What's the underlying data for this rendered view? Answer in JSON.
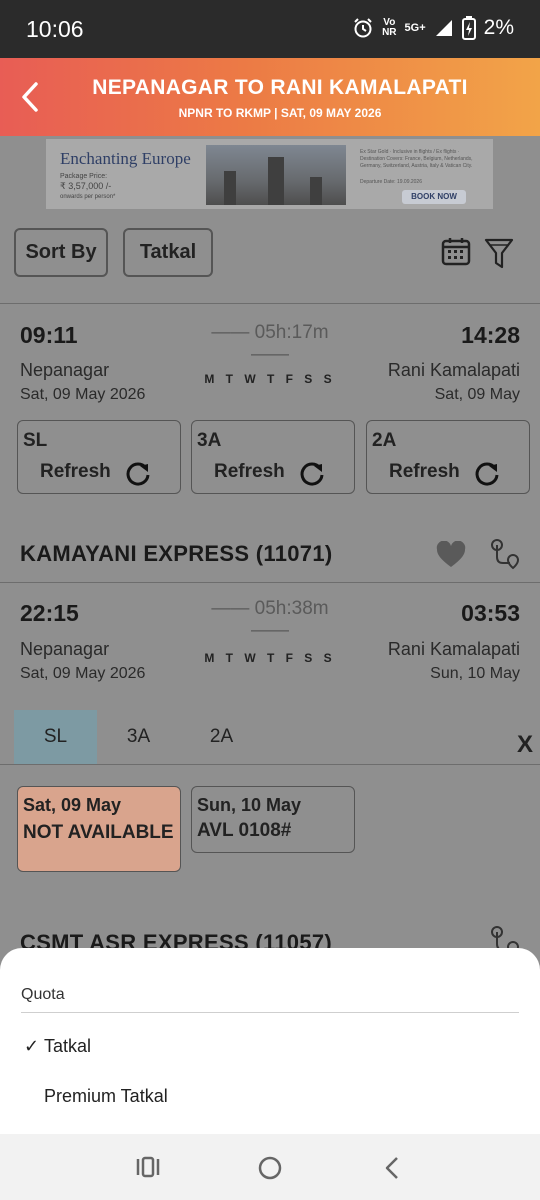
{
  "status_bar": {
    "time": "10:06",
    "network_top": "Vo",
    "network_bottom": "NR",
    "signal": "5G+",
    "battery": "2%"
  },
  "header": {
    "title": "NEPANAGAR TO RANI KAMALAPATI",
    "subtitle": "NPNR TO RKMP | SAT, 09 MAY  2026"
  },
  "banner": {
    "title": "Enchanting Europe",
    "subtitle": "Package Price:",
    "price": "₹ 3,57,000 /-",
    "price_note": "onwards per person*",
    "details": "Ex Star Gold · Inclusive in flights / Ex flights · Destination Covers: France, Belgium, Netherlands, Germany, Switzerland, Austria, Italy & Vatican City.",
    "departure": "Departure Date: 19.09.2026",
    "cta": "BOOK NOW"
  },
  "filters": {
    "sort_label": "Sort By",
    "quota_label": "Tatkal"
  },
  "train1": {
    "dep_time": "09:11",
    "duration": "05h:17m",
    "arr_time": "14:28",
    "from": "Nepanagar",
    "to": "Rani Kamalapati",
    "dep_date": "Sat, 09 May  2026",
    "arr_date": "Sat, 09 May",
    "days": "M T W T F S S",
    "classes": [
      {
        "code": "SL",
        "action": "Refresh"
      },
      {
        "code": "3A",
        "action": "Refresh"
      },
      {
        "code": "2A",
        "action": "Refresh"
      }
    ]
  },
  "train2": {
    "name": "KAMAYANI EXPRESS (11071)",
    "dep_time": "22:15",
    "duration": "05h:38m",
    "arr_time": "03:53",
    "from": "Nepanagar",
    "to": "Rani Kamalapati",
    "dep_date": "Sat, 09 May  2026",
    "arr_date": "Sun, 10 May",
    "days": "M T W T F S S",
    "tabs": [
      "SL",
      "3A",
      "2A"
    ],
    "close": "X",
    "availability": [
      {
        "date": "Sat, 09 May",
        "status": "NOT AVAILABLE",
        "color": "#d9a48d"
      },
      {
        "date": "Sun, 10 May",
        "status": "AVL 0108#"
      }
    ]
  },
  "train3": {
    "name": "CSMT ASR EXPRESS (11057)"
  },
  "quota_sheet": {
    "title": "Quota",
    "options": [
      {
        "label": "Tatkal",
        "selected": true
      },
      {
        "label": "Premium Tatkal",
        "selected": false
      }
    ],
    "check": "✓"
  },
  "colors": {
    "header_start": "#e85d55",
    "header_end": "#f2a448",
    "not_available": "#d9a48d",
    "active_tab": "#7d9aa3"
  }
}
